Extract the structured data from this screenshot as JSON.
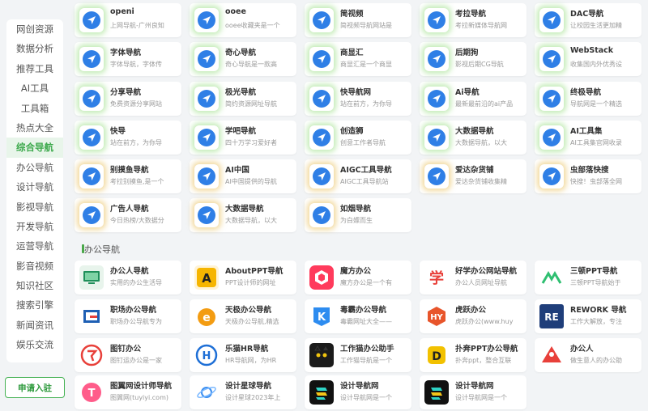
{
  "sidebar": {
    "items": [
      "网创资源",
      "数据分析",
      "推荐工具",
      "AI工具",
      "工具箱",
      "热点大全",
      "综合导航",
      "办公导航",
      "设计导航",
      "影视导航",
      "开发导航",
      "运营导航",
      "影音视频",
      "知识社区",
      "搜索引擎",
      "新闻资讯",
      "娱乐交流"
    ],
    "active_index": 6,
    "apply_label": "申请入驻"
  },
  "section_office": {
    "title": "办公导航"
  },
  "nav_cards": [
    {
      "title": "openi",
      "desc": "上网导航-广州良知"
    },
    {
      "title": "ooee",
      "desc": "ooee收藏夹是一个"
    },
    {
      "title": "简视频",
      "desc": "简视频导航网站是"
    },
    {
      "title": "考拉导航",
      "desc": "考拉新媒体导航网"
    },
    {
      "title": "DAC导航",
      "desc": "让校园生活更加精"
    },
    {
      "title": "字体导航",
      "desc": "字体导航，字体传"
    },
    {
      "title": "奇心导航",
      "desc": "奇心导航是一款高"
    },
    {
      "title": "商显汇",
      "desc": "商显汇是一个商显"
    },
    {
      "title": "后期狗",
      "desc": "影视后期CG导航"
    },
    {
      "title": "WebStack",
      "desc": "收集国内外优秀设"
    },
    {
      "title": "分享导航",
      "desc": "免费资源分享网站"
    },
    {
      "title": "极光导航",
      "desc": "简约资源网址导航"
    },
    {
      "title": "快导航网",
      "desc": "站在前方，为你导"
    },
    {
      "title": "Ai导航",
      "desc": "最新最前沿的ai产品"
    },
    {
      "title": "终极导航",
      "desc": "导航网是一个精选"
    },
    {
      "title": "快导",
      "desc": "站在前方，为你导"
    },
    {
      "title": "学吧导航",
      "desc": "四十万学习爱好者"
    },
    {
      "title": "创造狮",
      "desc": "创意工作者导航"
    },
    {
      "title": "大数据导航",
      "desc": "大数据导航，以大"
    },
    {
      "title": "AI工具集",
      "desc": "AI工具集官网收录"
    },
    {
      "title": "别摸鱼导航",
      "desc": "考拉别摸鱼,是一个"
    },
    {
      "title": "AI中国",
      "desc": "AI中国提供的导航"
    },
    {
      "title": "AIGC工具导航",
      "desc": "AIGC工具导航站"
    },
    {
      "title": "爱达杂货铺",
      "desc": "爱达杂货铺收集精"
    },
    {
      "title": "虫部落快搜",
      "desc": "快搜！虫部落全网"
    },
    {
      "title": "广告人导航",
      "desc": "今日热榜/大数据分"
    },
    {
      "title": "大数据导航",
      "desc": "大数据导航，以大"
    },
    {
      "title": "如烟导航",
      "desc": "为白嫖而生"
    }
  ],
  "office_cards": [
    {
      "title": "办公人导航",
      "desc": "实用的办公生活导",
      "icon": "office-person-icon"
    },
    {
      "title": "AboutPPT导航",
      "desc": "PPT设计师的网址",
      "icon": "aboutppt-logo-icon"
    },
    {
      "title": "魔方办公",
      "desc": "魔方办公是一个有",
      "icon": "cube-logo-icon"
    },
    {
      "title": "好学办公网站导航",
      "desc": "办公人员网址导航",
      "icon": "xue-logo-icon"
    },
    {
      "title": "三顿PPT导航",
      "desc": "三顿PPT导航始于",
      "icon": "sandun-logo-icon"
    },
    {
      "title": "职场办公导航",
      "desc": "职场办公导航专为",
      "icon": "g-logo-icon"
    },
    {
      "title": "天极办公导航",
      "desc": "天极办公导航,精选",
      "icon": "e-logo-icon"
    },
    {
      "title": "毒霸办公导航",
      "desc": "毒霸网址大全——",
      "icon": "k-logo-icon"
    },
    {
      "title": "虎跃办公",
      "desc": "虎跃办公(www.huy",
      "icon": "hy-logo-icon"
    },
    {
      "title": "REWORK 导航",
      "desc": "工作大解放，专注",
      "icon": "re-logo-icon"
    },
    {
      "title": "图钉办公",
      "desc": "图钉运办公是一家",
      "icon": "pin-logo-icon"
    },
    {
      "title": "乐猫HR导航",
      "desc": "HR导航网，为HR",
      "icon": "h-logo-icon"
    },
    {
      "title": "工作猫办公助手",
      "desc": "工作猫导航是一个",
      "icon": "cat-logo-icon"
    },
    {
      "title": "扑奔PPT办公导航",
      "desc": "扑奔ppt，整合互联",
      "icon": "d-logo-icon"
    },
    {
      "title": "办公人",
      "desc": "做生意人的办公助",
      "icon": "person-logo-icon"
    },
    {
      "title": "图翼网设计师导航",
      "desc": "图翼网(tuyiyi.com)",
      "icon": "t-logo-icon"
    },
    {
      "title": "设计星球导航",
      "desc": "设计星球2023年上",
      "icon": "planet-logo-icon"
    },
    {
      "title": "设计导航网",
      "desc": "设计导航网是一个",
      "icon": "layers-logo-icon"
    },
    {
      "title": "设计导航网",
      "desc": "设计导航网是一个",
      "icon": "layers-logo-icon"
    }
  ]
}
